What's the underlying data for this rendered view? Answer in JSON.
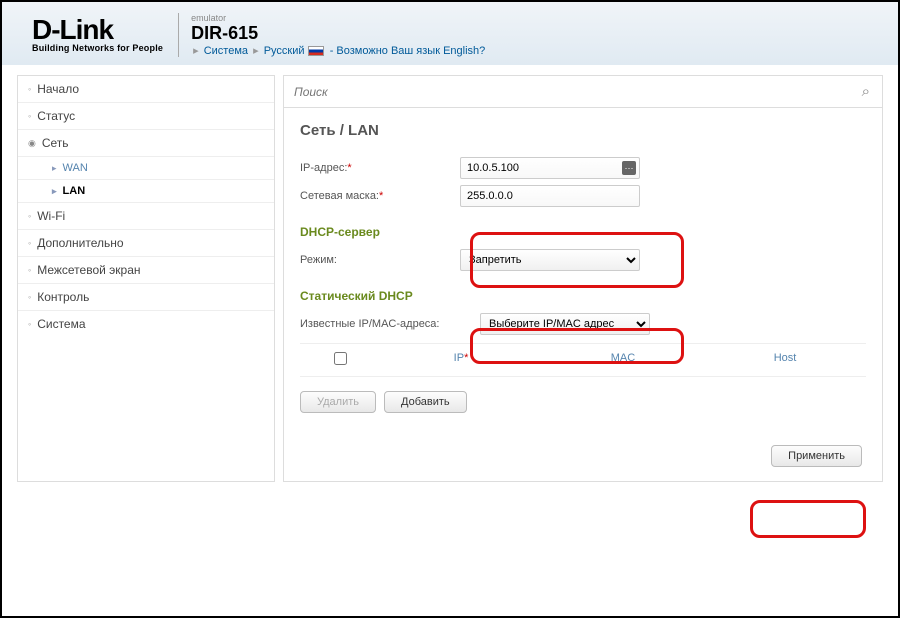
{
  "header": {
    "logo": "D-Link",
    "tagline": "Building Networks for People",
    "emulator": "emulator",
    "model": "DIR-615",
    "link_system": "Система",
    "link_lang": "Русский",
    "lang_prompt": "- Возможно Ваш язык English?"
  },
  "sidebar": {
    "items": [
      {
        "label": "Начало"
      },
      {
        "label": "Статус"
      },
      {
        "label": "Сеть",
        "open": true,
        "children": [
          {
            "label": "WAN"
          },
          {
            "label": "LAN",
            "active": true
          }
        ]
      },
      {
        "label": "Wi-Fi"
      },
      {
        "label": "Дополнительно"
      },
      {
        "label": "Межсетевой экран"
      },
      {
        "label": "Контроль"
      },
      {
        "label": "Система"
      }
    ]
  },
  "search": {
    "placeholder": "Поиск"
  },
  "page": {
    "title": "Сеть / LAN",
    "ip_label": "IP-адрес:",
    "ip_value": "10.0.5.100",
    "mask_label": "Сетевая маска:",
    "mask_value": "255.0.0.0",
    "dhcp_head": "DHCP-сервер",
    "mode_label": "Режим:",
    "mode_value": "Запретить",
    "static_head": "Статический DHCP",
    "known_label": "Известные IP/MAC-адреса:",
    "known_value": "Выберите IP/MAC адрес",
    "col_ip": "IP",
    "col_mac": "MAC",
    "col_host": "Host",
    "btn_delete": "Удалить",
    "btn_add": "Добавить",
    "btn_apply": "Применить"
  }
}
